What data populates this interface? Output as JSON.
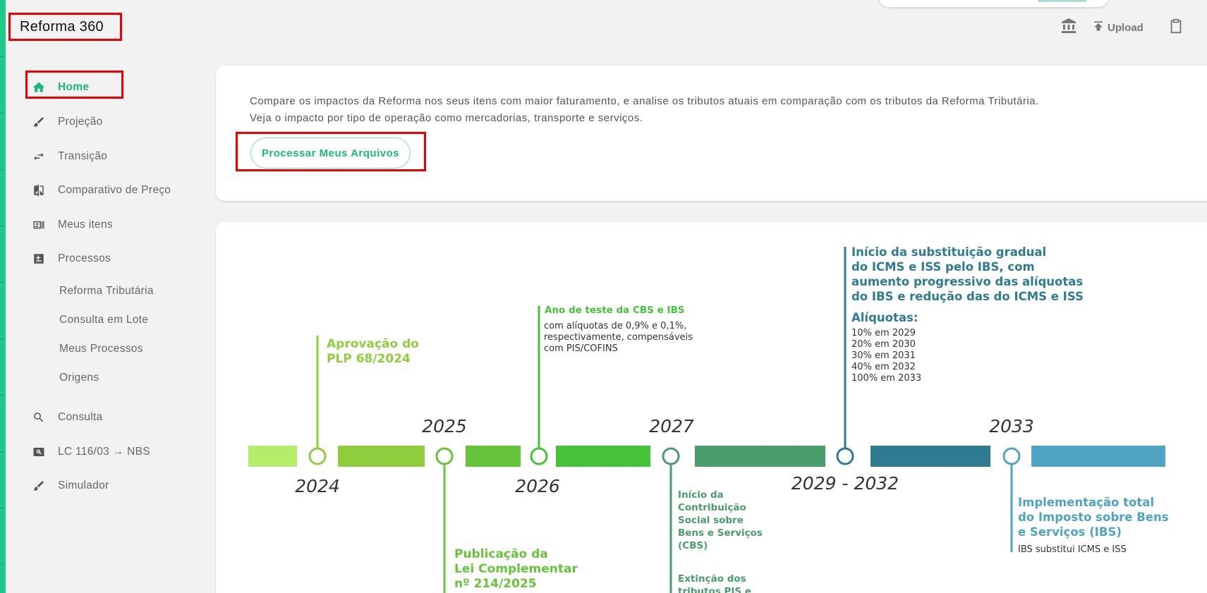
{
  "app": {
    "title": "Reforma 360"
  },
  "toolbar": {
    "upload_label": "Upload"
  },
  "sidebar": {
    "items": [
      {
        "label": "Home",
        "icon": "home-icon",
        "active": true
      },
      {
        "label": "Projeção",
        "icon": "brush-icon"
      },
      {
        "label": "Transição",
        "icon": "swap-icon"
      },
      {
        "label": "Comparativo de Preço",
        "icon": "compare-icon"
      },
      {
        "label": "Meus itens",
        "icon": "id-card-icon"
      },
      {
        "label": "Processos",
        "icon": "puzzle-icon"
      }
    ],
    "subitems": [
      {
        "label": "Reforma Tributária"
      },
      {
        "label": "Consulta em Lote"
      },
      {
        "label": "Meus Processos"
      },
      {
        "label": "Origens"
      }
    ],
    "bottom_items": [
      {
        "label": "Consulta",
        "icon": "search-icon"
      },
      {
        "label": "LC 116/03 → NBS",
        "icon": "screen-search-icon"
      },
      {
        "label": "Simulador",
        "icon": "brush-icon"
      }
    ]
  },
  "intro": {
    "line1": "Compare os impactos da Reforma nos seus itens com maior faturamento, e analise os tributos atuais em comparação com os tributos da Reforma Tributária.",
    "line2": "Veja o impacto por tipo de operação como mercadorias, transporte e serviços.",
    "button_label": "Processar Meus Arquivos"
  },
  "timeline": {
    "years": [
      "2024",
      "2025",
      "2026",
      "2027",
      "2029 - 2032",
      "2033"
    ],
    "events": {
      "plp": [
        "Aprovação do",
        "PLP 68/2024"
      ],
      "lc": [
        "Publicação da",
        "Lei Complementar",
        "nº 214/2025"
      ],
      "teste_title": "Ano de teste da CBS e IBS",
      "teste_body": [
        "com alíquotas de 0,9% e 0,1%,",
        "respectivamente, compensáveis",
        "com PIS/COFINS"
      ],
      "cbs": [
        "Início da",
        "Contribuição",
        "Social sobre",
        "Bens e Serviços",
        "(CBS)"
      ],
      "extincao": [
        "Extinção dos",
        "tributos PIS e"
      ],
      "substituicao": [
        "Início da substituição gradual",
        "do ICMS e ISS pelo IBS, com",
        "aumento progressivo das alíquotas",
        "do IBS e redução das do ICMS e ISS"
      ],
      "aliquotas_title": "Alíquotas:",
      "aliquotas": [
        "10% em 2029",
        "20% em 2030",
        "30% em 2031",
        "40% em 2032",
        "100% em 2033"
      ],
      "ibs_title": [
        "Implementação total",
        "do Imposto sobre Bens",
        "e Serviços (IBS)"
      ],
      "ibs_body": "IBS substitui ICMS e ISS"
    }
  },
  "colors": {
    "accent": "#1bb877",
    "c2024": "#b5ec6a",
    "c2025": "#8fcd3e",
    "c2026": "#66c43a",
    "c2027": "#45c13a",
    "c2028": "#4a9c6a",
    "c2029": "#2e7b92",
    "c2033": "#4fa3c4"
  }
}
